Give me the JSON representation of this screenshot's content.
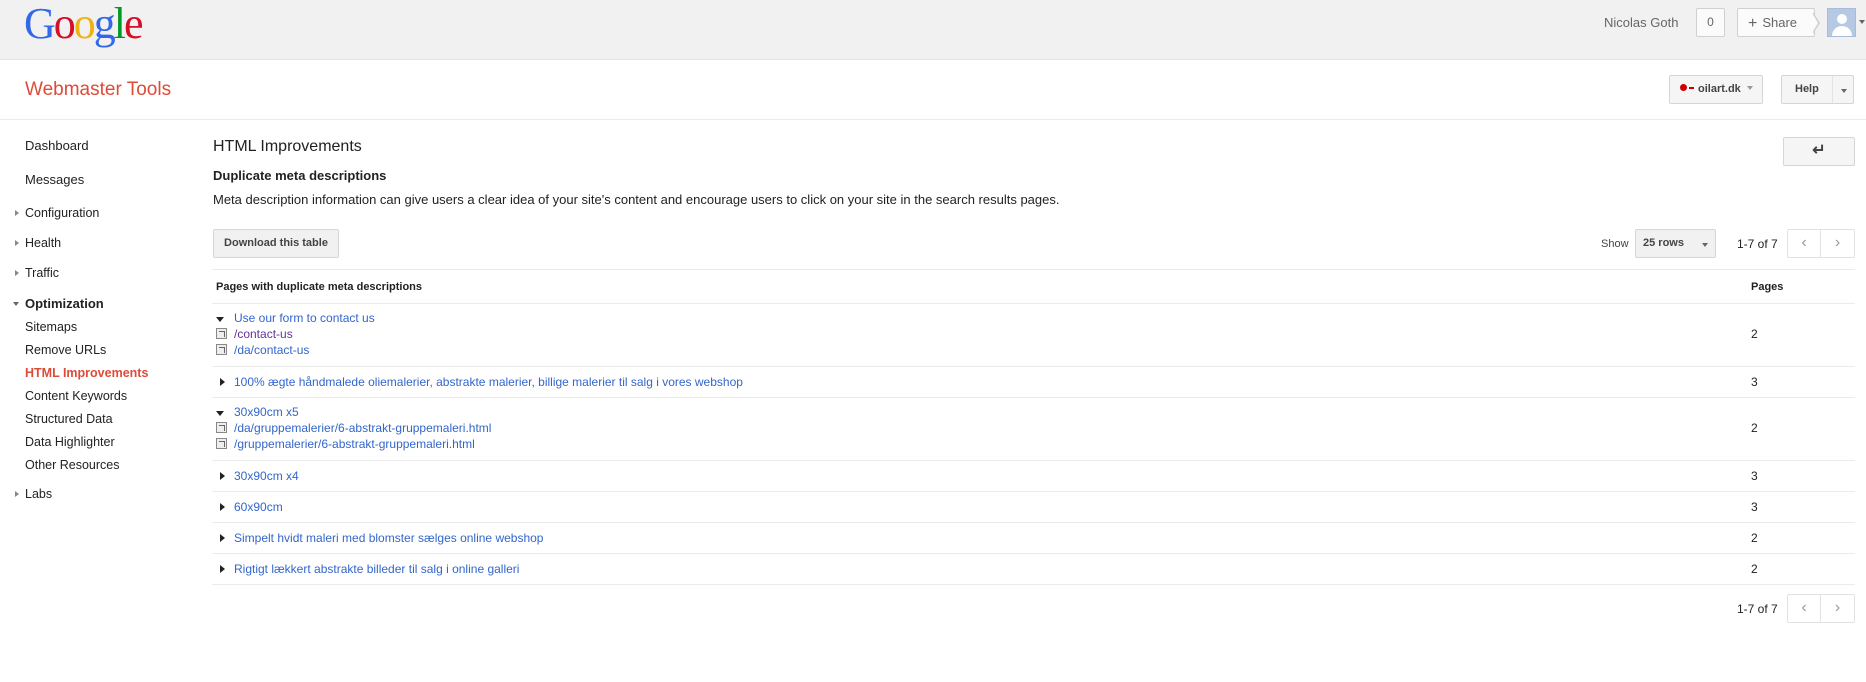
{
  "google_logo": [
    "G",
    "o",
    "o",
    "g",
    "l",
    "e"
  ],
  "logo_colors": [
    "#3369e8",
    "#d50f25",
    "#eeb211",
    "#3369e8",
    "#009925",
    "#d50f25"
  ],
  "topbar": {
    "user_name": "Nicolas Goth",
    "notification_count": "0",
    "share_label": "Share"
  },
  "header": {
    "app_title": "Webmaster Tools",
    "site_name": "oilart.dk",
    "help_label": "Help"
  },
  "sidebar": {
    "items": [
      {
        "label": "Dashboard"
      },
      {
        "label": "Messages"
      },
      {
        "label": "Configuration"
      },
      {
        "label": "Health"
      },
      {
        "label": "Traffic"
      },
      {
        "label": "Optimization"
      },
      {
        "label": "Sitemaps"
      },
      {
        "label": "Remove URLs"
      },
      {
        "label": "HTML Improvements"
      },
      {
        "label": "Content Keywords"
      },
      {
        "label": "Structured Data"
      },
      {
        "label": "Data Highlighter"
      },
      {
        "label": "Other Resources"
      },
      {
        "label": "Labs"
      }
    ]
  },
  "main": {
    "page_title": "HTML Improvements",
    "back_icon": "back-arrow-icon",
    "section_title": "Duplicate meta descriptions",
    "section_desc": "Meta description information can give users a clear idea of your site's content and encourage users to click on your site in the search results pages.",
    "download_label": "Download this table",
    "show_label": "Show",
    "rows_value": "25 rows",
    "range_top": "1-7 of 7",
    "range_bottom": "1-7 of 7"
  },
  "table": {
    "headers": [
      "Pages with duplicate meta descriptions",
      "Pages"
    ],
    "rows": [
      {
        "description": "Use our form to contact us",
        "pages": "2",
        "expanded": true,
        "urls": [
          "/contact-us",
          "/da/contact-us"
        ]
      },
      {
        "description": "100% ægte håndmalede oliemalerier, abstrakte malerier, billige malerier til salg i vores webshop",
        "pages": "3",
        "expanded": false
      },
      {
        "description": "30x90cm x5",
        "pages": "2",
        "expanded": true,
        "urls": [
          "/da/gruppemalerier/6-abstrakt-gruppemaleri.html",
          "/gruppemalerier/6-abstrakt-gruppemaleri.html"
        ]
      },
      {
        "description": "30x90cm x4",
        "pages": "3",
        "expanded": false
      },
      {
        "description": "60x90cm",
        "pages": "3",
        "expanded": false
      },
      {
        "description": "Simpelt hvidt maleri med blomster sælges online webshop",
        "pages": "2",
        "expanded": false
      },
      {
        "description": "Rigtigt lækkert abstrakte billeder til salg i online galleri",
        "pages": "2",
        "expanded": false
      }
    ]
  },
  "colors": {
    "accent_red": "#dd4b39",
    "link_blue": "#3366cc",
    "visited_purple": "#663399"
  }
}
